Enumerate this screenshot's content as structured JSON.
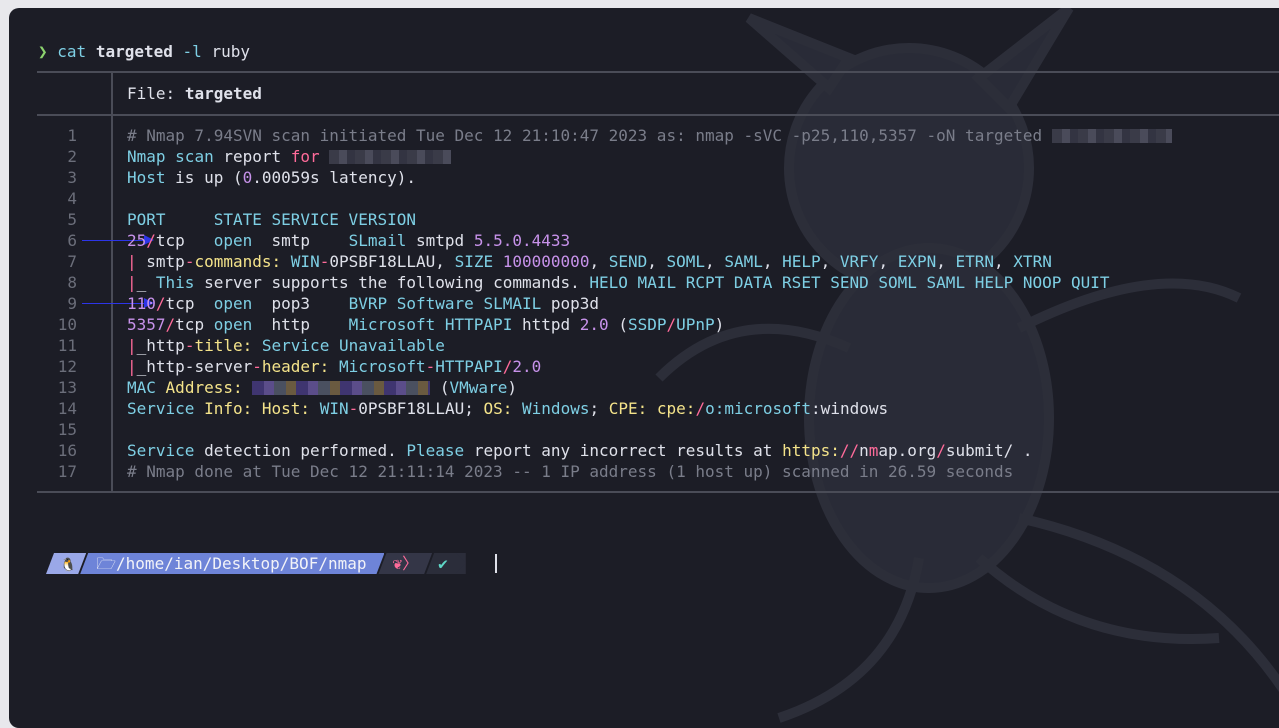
{
  "command": {
    "chevron": "❯",
    "program": "cat",
    "file": "targeted",
    "flag": "-l",
    "lang": "ruby"
  },
  "header": {
    "label": "File:",
    "filename": "targeted"
  },
  "lines": [
    {
      "n": "1",
      "html": "<span class='grey'># Nmap 7.94SVN scan initiated Tue Dec 12 21:10:47 2023 as: nmap -sVC -p25,110,5357 -oN targeted </span><span class='blur' style='width:120px'></span>"
    },
    {
      "n": "2",
      "html": "<span class='cyan'>Nmap</span> <span class='cyan'>scan</span> <span class='white'>report</span> <span class='pink'>for</span> <span class='blur' style='width:122px'></span>"
    },
    {
      "n": "3",
      "html": "<span class='cyan'>Host</span> <span class='white'>is up (</span><span class='purple'>0</span><span class='white'>.00059s latency).</span>"
    },
    {
      "n": "4",
      "html": ""
    },
    {
      "n": "5",
      "html": "<span class='cyan'>PORT     STATE SERVICE VERSION</span>"
    },
    {
      "n": "6",
      "html": "<span class='purple'>25</span><span class='pink'>/</span><span class='white'>tcp   </span><span class='cyan'>open</span><span class='white'>  smtp    </span><span class='cyan'>SLmail</span> <span class='white'>smtpd</span> <span class='purple'>5.5.0.4433</span>",
      "arrow": true
    },
    {
      "n": "7",
      "html": "<span class='pink'>|</span> <span class='white'>smtp</span><span class='pink'>-</span><span class='yellow'>commands:</span> <span class='cyan'>WIN</span><span class='pink'>-</span><span class='white'>0PSBF18LLAU, </span><span class='cyan'>SIZE</span> <span class='purple'>100000000</span><span class='white'>, </span><span class='cyan'>SEND</span><span class='white'>, </span><span class='cyan'>SOML</span><span class='white'>, </span><span class='cyan'>SAML</span><span class='white'>, </span><span class='cyan'>HELP</span><span class='white'>, </span><span class='cyan'>VRFY</span><span class='white'>, </span><span class='cyan'>EXPN</span><span class='white'>, </span><span class='cyan'>ETRN</span><span class='white'>, </span><span class='cyan'>XTRN</span>"
    },
    {
      "n": "8",
      "html": "<span class='pink'>|</span><span class='white'>_ </span><span class='cyan'>This</span> <span class='white'>server supports the following commands. </span><span class='cyan'>HELO MAIL RCPT DATA RSET SEND SOML SAML HELP NOOP QUIT</span>"
    },
    {
      "n": "9",
      "html": "<span class='purple'>110</span><span class='pink'>/</span><span class='white'>tcp  </span><span class='cyan'>open</span><span class='white'>  pop3    </span><span class='cyan'>BVRP Software SLMAIL</span> <span class='white'>pop3d</span>",
      "arrow": true
    },
    {
      "n": "10",
      "html": "<span class='purple'>5357</span><span class='pink'>/</span><span class='white'>tcp </span><span class='cyan'>open</span><span class='white'>  http    </span><span class='cyan'>Microsoft HTTPAPI</span> <span class='white'>httpd</span> <span class='purple'>2.0</span> <span class='white'>(</span><span class='cyan'>SSDP</span><span class='pink'>/</span><span class='cyan'>UPnP</span><span class='white'>)</span>"
    },
    {
      "n": "11",
      "html": "<span class='pink'>|</span><span class='white'>_http</span><span class='pink'>-</span><span class='yellow'>title:</span> <span class='cyan'>Service Unavailable</span>"
    },
    {
      "n": "12",
      "html": "<span class='pink'>|</span><span class='white'>_http-server</span><span class='pink'>-</span><span class='yellow'>header:</span> <span class='cyan'>Microsoft</span><span class='pink'>-</span><span class='cyan'>HTTPAPI</span><span class='pink'>/</span><span class='purple'>2.0</span>"
    },
    {
      "n": "13",
      "html": "<span class='cyan'>MAC</span> <span class='yellow'>Address:</span> <span class='blur c' style='width:178px'></span> <span class='white'>(</span><span class='cyan'>VMware</span><span class='white'>)</span>"
    },
    {
      "n": "14",
      "html": "<span class='cyan'>Service</span> <span class='yellow'>Info:</span> <span class='yellow'>Host:</span> <span class='cyan'>WIN</span><span class='pink'>-</span><span class='white'>0PSBF18LLAU; </span><span class='yellow'>OS:</span> <span class='cyan'>Windows</span><span class='white'>; </span><span class='yellow'>CPE:</span> <span class='yellow'>cpe:</span><span class='pink'>/</span><span class='cyan'>o:microsoft</span><span class='white'>:windows</span>"
    },
    {
      "n": "15",
      "html": ""
    },
    {
      "n": "16",
      "html": "<span class='cyan'>Service</span> <span class='white'>detection performed. </span><span class='cyan'>Please</span> <span class='white'>report any incorrect results at </span><span class='yellow'>https:</span><span class='pink'>//</span><span class='white'>n</span><span class='pink'>m</span><span class='white'>ap.org</span><span class='pink'>/</span><span class='white'>submit/ .</span>"
    },
    {
      "n": "17",
      "html": "<span class='grey'># Nmap done at Tue Dec 12 21:11:14 2023 -- 1 IP address (1 host up) scanned in 26.59 seconds</span>"
    }
  ],
  "powerline": {
    "os_icon": "🐧",
    "folder_icon": "🗁",
    "path": "/home/ian/Desktop/BOF/nmap",
    "git_icon": "❦",
    "sep": "〉",
    "check": "✔"
  }
}
